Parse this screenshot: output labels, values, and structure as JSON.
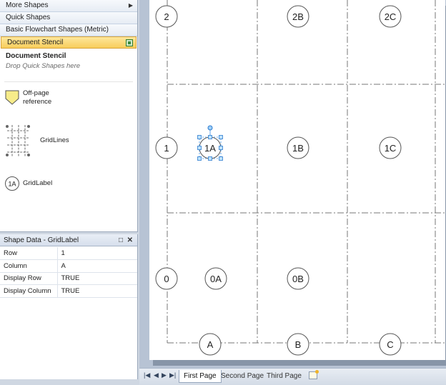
{
  "shapes_pane": {
    "stencils": [
      "More Shapes",
      "Quick Shapes",
      "Basic Flowchart Shapes (Metric)",
      "Document Stencil"
    ],
    "stencil_title": "Document Stencil",
    "stencil_hint": "Drop Quick Shapes here",
    "masters": {
      "offpage": "Off-page\nreference",
      "gridlines": "GridLines",
      "gridlabel": "GridLabel",
      "gridlabel_icon_text": "1A"
    }
  },
  "shape_data": {
    "title": "Shape Data - GridLabel",
    "rows": [
      {
        "key": "Row",
        "value": "1"
      },
      {
        "key": "Column",
        "value": "A"
      },
      {
        "key": "Display Row",
        "value": "TRUE"
      },
      {
        "key": "Display Column",
        "value": "TRUE"
      }
    ]
  },
  "canvas": {
    "labels": {
      "r2": "2",
      "c2B": "2B",
      "c2C": "2C",
      "r1": "1",
      "c1A": "1A",
      "c1B": "1B",
      "c1C": "1C",
      "r0": "0",
      "c0A": "0A",
      "c0B": "0B",
      "colA": "A",
      "colB": "B",
      "colC": "C"
    }
  },
  "page_tabs": [
    "First Page",
    "Second Page",
    "Third Page"
  ],
  "colors": {
    "selection": "#3a8ee6",
    "active_stencil": "#f8cd5b",
    "offpage_fill": "#f7ec8a"
  }
}
